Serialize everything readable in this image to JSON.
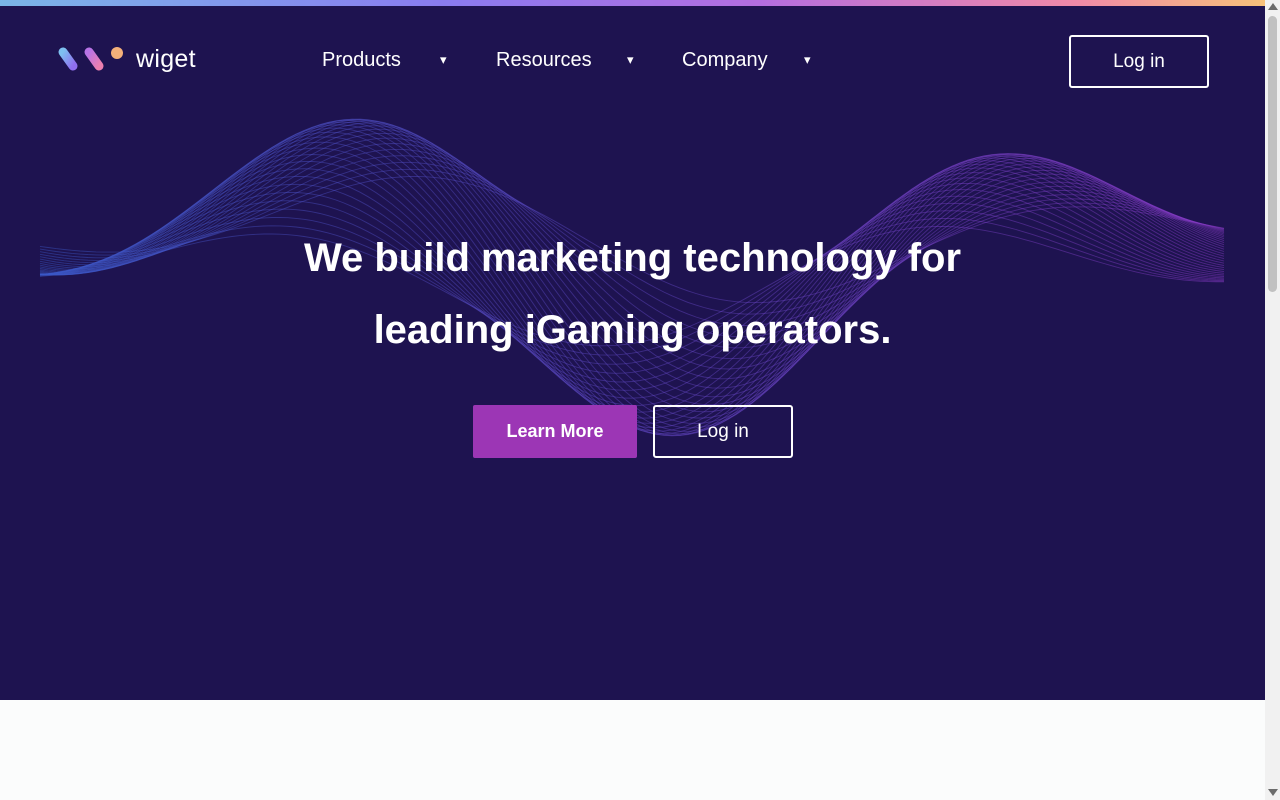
{
  "brand": {
    "name": "wiget",
    "logo_icon": "wiget-logo-icon"
  },
  "nav": {
    "items": [
      {
        "label": "Products",
        "caret": "▾"
      },
      {
        "label": "Resources",
        "caret": "▾"
      },
      {
        "label": "Company",
        "caret": "▾"
      }
    ],
    "login_label": "Log in"
  },
  "hero": {
    "headline_line1": "We build marketing technology for",
    "headline_line2": "leading iGaming operators.",
    "learn_more_label": "Learn More",
    "login_label": "Log in"
  },
  "colors": {
    "hero_background": "#1e1350",
    "accent_button": "#9c36b5",
    "page_background": "#fbfcfc",
    "wave_left": "#3a58c8",
    "wave_right": "#8a3ac8"
  }
}
